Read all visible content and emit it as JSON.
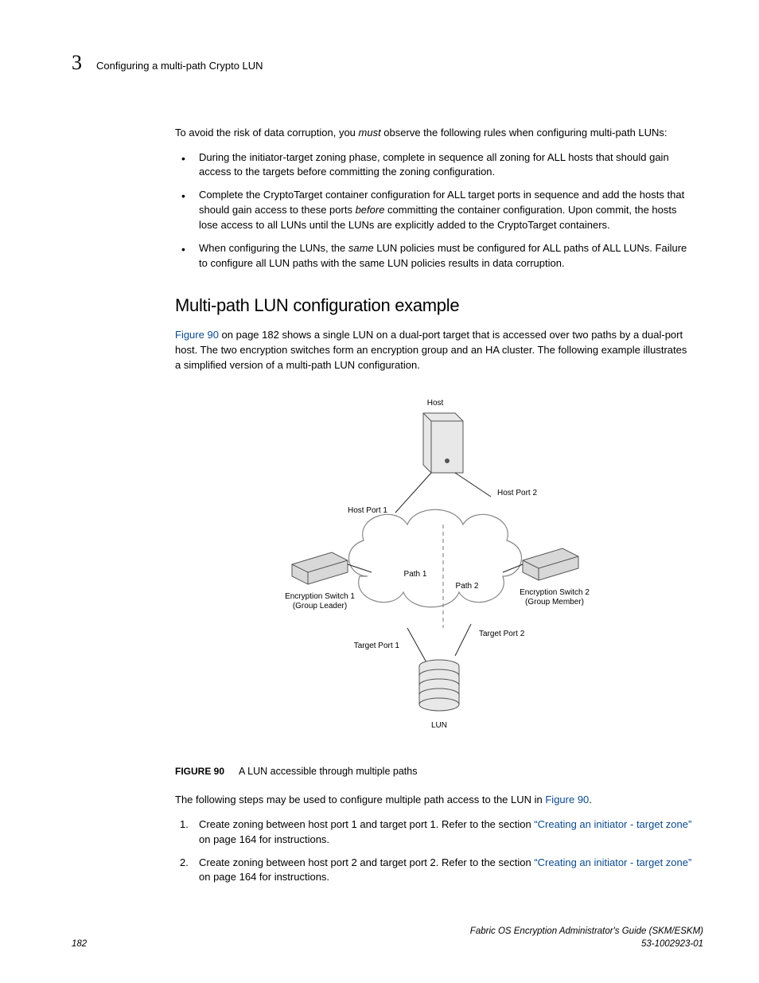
{
  "header": {
    "chapter_number": "3",
    "running_head": "Configuring a multi-path Crypto LUN"
  },
  "intro": {
    "lead_pre": "To avoid the risk of data corruption, you ",
    "lead_emph": "must",
    "lead_post": " observe the following rules when configuring multi-path LUNs:"
  },
  "bullets": {
    "b1": "During the initiator-target zoning phase, complete in sequence all zoning for ALL hosts that should gain access to the targets before committing the zoning configuration.",
    "b2_pre": "Complete the CryptoTarget container configuration for ALL target ports in sequence and add the hosts that should gain access to these ports ",
    "b2_emph": "before",
    "b2_post": " committing the container configuration. Upon commit, the hosts lose access to all LUNs until the LUNs are explicitly added to the CryptoTarget containers.",
    "b3_pre": "When configuring the LUNs, the ",
    "b3_emph": "same",
    "b3_post": " LUN policies must be configured for ALL paths of ALL LUNs. Failure to configure all LUN paths with the same LUN policies results in data corruption."
  },
  "section_heading": "Multi-path LUN configuration example",
  "section_para": {
    "xref1": "Figure 90",
    "rest": " on page 182 shows a single LUN on a dual-port target that is accessed over two paths by a dual-port host. The two encryption switches form an encryption group and an HA cluster. The following example illustrates a simplified version of a multi-path LUN configuration."
  },
  "diagram": {
    "host": "Host",
    "host_port_1": "Host Port 1",
    "host_port_2": "Host Port 2",
    "path_1": "Path 1",
    "path_2": "Path 2",
    "enc_sw_1_l1": "Encryption Switch 1",
    "enc_sw_1_l2": "(Group Leader)",
    "enc_sw_2_l1": "Encryption Switch 2",
    "enc_sw_2_l2": "(Group Member)",
    "target_port_1": "Target Port 1",
    "target_port_2": "Target Port 2",
    "lun": "LUN"
  },
  "figure_caption": {
    "label": "FIGURE 90",
    "text": "A LUN accessible through multiple paths"
  },
  "followup": {
    "pre": "The following steps may be used to configure multiple path access to the LUN in ",
    "xref": "Figure 90",
    "post": "."
  },
  "steps": {
    "s1_pre": "Create zoning between host port 1 and target port 1. Refer to the section ",
    "s1_xref": "“Creating an initiator - target zone”",
    "s1_post": " on page 164 for instructions.",
    "s2_pre": "Create zoning between host port 2 and target port 2. Refer to the section ",
    "s2_xref": "“Creating an initiator - target zone”",
    "s2_post": " on page 164 for instructions."
  },
  "footer": {
    "page": "182",
    "title": "Fabric OS Encryption Administrator's Guide (SKM/ESKM)",
    "docnum": "53-1002923-01"
  }
}
